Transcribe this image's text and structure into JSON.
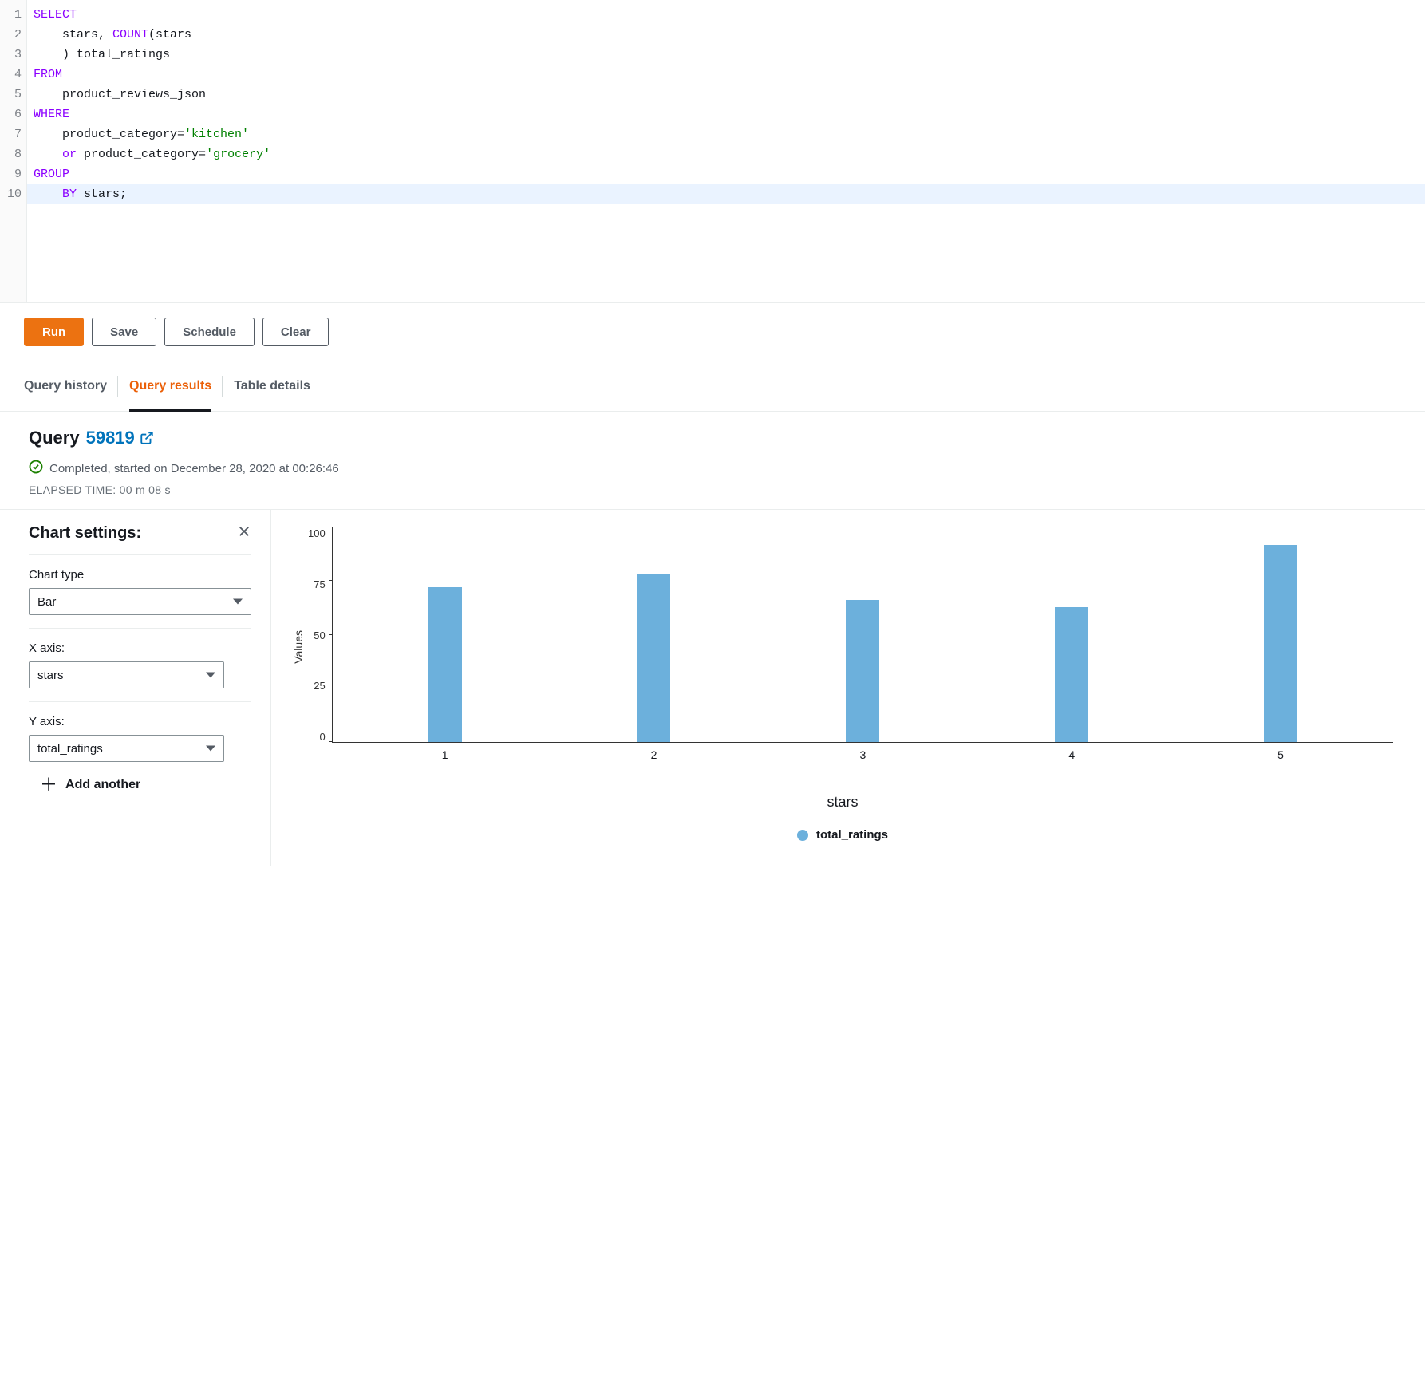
{
  "editor": {
    "lines": [
      {
        "n": "1",
        "segments": [
          {
            "t": "SELECT",
            "c": "kw-purple"
          }
        ]
      },
      {
        "n": "2",
        "segments": [
          {
            "t": "    stars, "
          },
          {
            "t": "COUNT",
            "c": "kw-purple"
          },
          {
            "t": "(stars"
          }
        ]
      },
      {
        "n": "3",
        "segments": [
          {
            "t": "    ) total_ratings"
          }
        ]
      },
      {
        "n": "4",
        "segments": [
          {
            "t": "FROM",
            "c": "kw-purple"
          }
        ]
      },
      {
        "n": "5",
        "segments": [
          {
            "t": "    product_reviews_json"
          }
        ]
      },
      {
        "n": "6",
        "segments": [
          {
            "t": "WHERE",
            "c": "kw-purple"
          }
        ]
      },
      {
        "n": "7",
        "segments": [
          {
            "t": "    product_category="
          },
          {
            "t": "'kitchen'",
            "c": "kw-str"
          }
        ]
      },
      {
        "n": "8",
        "segments": [
          {
            "t": "    "
          },
          {
            "t": "or",
            "c": "kw-purple"
          },
          {
            "t": " product_category="
          },
          {
            "t": "'grocery'",
            "c": "kw-str"
          }
        ]
      },
      {
        "n": "9",
        "segments": [
          {
            "t": "GROUP",
            "c": "kw-purple"
          }
        ]
      },
      {
        "n": "10",
        "segments": [
          {
            "t": "    "
          },
          {
            "t": "BY",
            "c": "kw-purple"
          },
          {
            "t": " stars;"
          }
        ],
        "hl": true
      }
    ]
  },
  "toolbar": {
    "run": "Run",
    "save": "Save",
    "schedule": "Schedule",
    "clear": "Clear"
  },
  "tabs": {
    "history": "Query history",
    "results": "Query results",
    "table": "Table details"
  },
  "results": {
    "title_prefix": "Query ",
    "query_id": "59819",
    "status": "Completed, started on December 28, 2020 at 00:26:46",
    "elapsed": "ELAPSED TIME: 00 m 08 s"
  },
  "chart_settings": {
    "title": "Chart settings:",
    "chart_type_label": "Chart type",
    "chart_type_value": "Bar",
    "x_label": "X axis:",
    "x_value": "stars",
    "y_label": "Y axis:",
    "y_value": "total_ratings",
    "add_another": "Add another"
  },
  "chart_data": {
    "type": "bar",
    "categories": [
      "1",
      "2",
      "3",
      "4",
      "5"
    ],
    "values": [
      72,
      78,
      66,
      63,
      92
    ],
    "series_name": "total_ratings",
    "xlabel": "stars",
    "ylabel": "Values",
    "ylim": [
      0,
      100
    ],
    "y_ticks": [
      0,
      25,
      50,
      75,
      100
    ]
  }
}
